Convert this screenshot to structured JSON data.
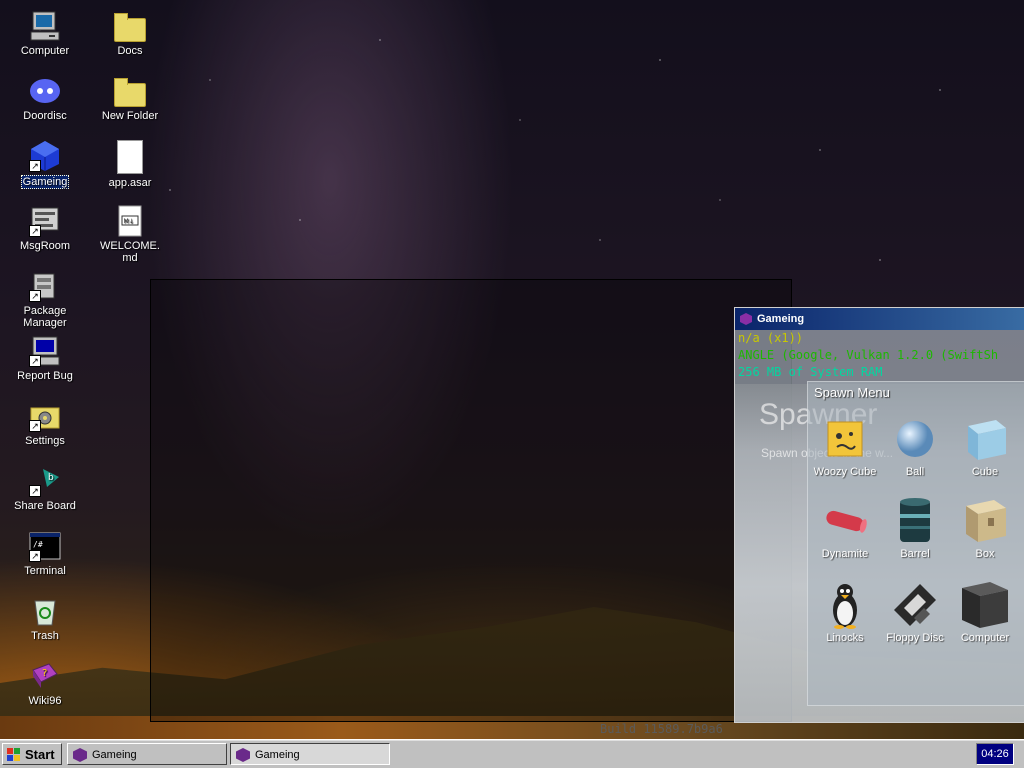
{
  "desktop": {
    "icons": [
      {
        "label": "Computer",
        "icon": "computer-icon"
      },
      {
        "label": "Doordisc",
        "icon": "chat-app-icon"
      },
      {
        "label": "Gameing",
        "icon": "game-icon"
      },
      {
        "label": "MsgRoom",
        "icon": "message-room-icon"
      },
      {
        "label": "Package Manager",
        "icon": "package-icon"
      },
      {
        "label": "Report Bug",
        "icon": "bug-report-icon"
      },
      {
        "label": "Settings",
        "icon": "settings-folder-icon"
      },
      {
        "label": "Share Board",
        "icon": "share-board-icon"
      },
      {
        "label": "Terminal",
        "icon": "terminal-icon"
      },
      {
        "label": "Trash",
        "icon": "trash-icon"
      },
      {
        "label": "Wiki96",
        "icon": "wiki-book-icon"
      },
      {
        "label": "Docs",
        "icon": "folder-icon"
      },
      {
        "label": "New Folder",
        "icon": "folder-icon"
      },
      {
        "label": "app.asar",
        "icon": "file-icon"
      },
      {
        "label": "WELCOME.md",
        "icon": "markdown-file-icon"
      }
    ],
    "selected": "Gameing"
  },
  "game_window": {
    "title": "Gameing",
    "debug": {
      "line1": "n/a (x1))",
      "line2": "ANGLE (Google, Vulkan 1.2.0 (SwiftSh",
      "line3": "256 MB of System RAM"
    },
    "spawner_title": "Spawner",
    "spawner_sub": "Spawn objects in the w...",
    "spawn_menu": {
      "title": "Spawn Menu",
      "items": [
        {
          "label": "Woozy Cube"
        },
        {
          "label": "Ball"
        },
        {
          "label": "Cube"
        },
        {
          "label": "Dynamite"
        },
        {
          "label": "Barrel"
        },
        {
          "label": "Box"
        },
        {
          "label": "Linocks"
        },
        {
          "label": "Floppy Disc"
        },
        {
          "label": "Computer"
        }
      ]
    }
  },
  "build": "Build 11589.7b9a6",
  "taskbar": {
    "start": "Start",
    "tasks": [
      {
        "label": "Gameing",
        "active": false
      },
      {
        "label": "Gameing",
        "active": true
      }
    ],
    "clock": "04:26"
  }
}
